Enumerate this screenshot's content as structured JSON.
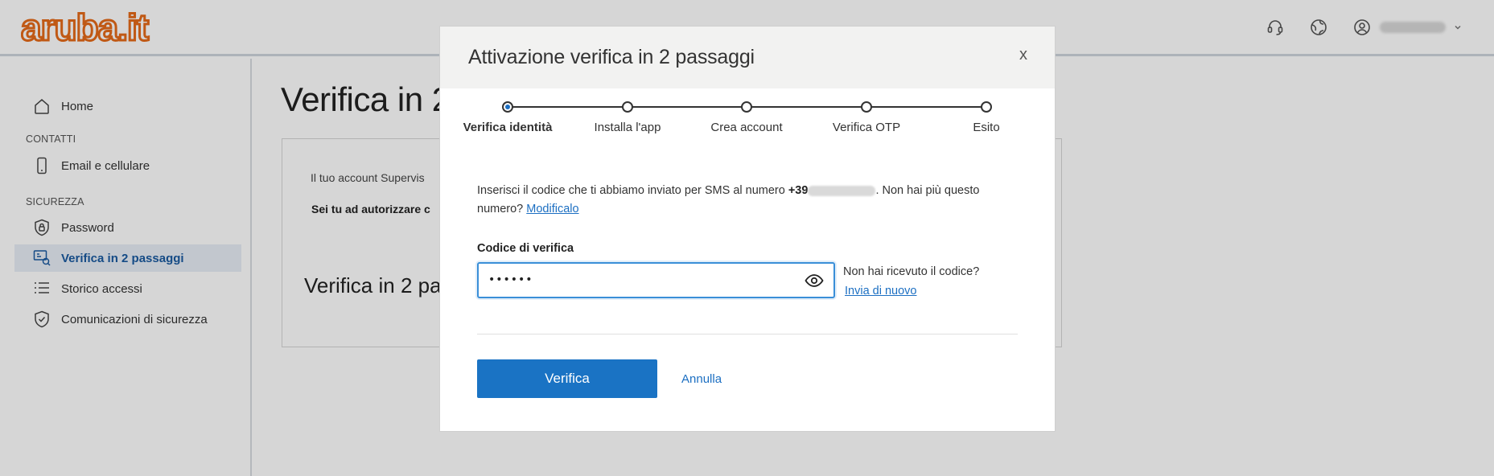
{
  "brand": {
    "logo_text": "aruba.it",
    "color": "#e56a1a"
  },
  "header": {
    "icons": [
      "headset-icon",
      "globe-icon",
      "user-circle-icon"
    ],
    "user_name": ""
  },
  "sidebar": {
    "home": "Home",
    "section_contacts": "CONTATTI",
    "email_phone": "Email e cellulare",
    "section_security": "SICUREZZA",
    "password": "Password",
    "two_step": "Verifica in 2 passaggi",
    "access_history": "Storico accessi",
    "security_comms": "Comunicazioni di sicurezza"
  },
  "main": {
    "title": "Verifica in 2",
    "card_text": "Il tuo account Supervis",
    "card_question": "Sei tu ad autorizzare c",
    "card_heading": "Verifica in 2 pas"
  },
  "modal": {
    "title": "Attivazione verifica in 2 passaggi",
    "close_label": "x",
    "steps": [
      {
        "label": "Verifica identità",
        "active": true
      },
      {
        "label": "Installa l'app",
        "active": false
      },
      {
        "label": "Crea account",
        "active": false
      },
      {
        "label": "Verifica OTP",
        "active": false
      },
      {
        "label": "Esito",
        "active": false
      }
    ],
    "info_prefix": "Inserisci il codice che ti abbiamo inviato per SMS al numero ",
    "phone_prefix": "+39",
    "info_suffix": ". Non hai più questo numero? ",
    "change_link": "Modificalo",
    "field_label": "Codice di verifica",
    "code_value": "••••••",
    "resend_question": "Non hai ricevuto il codice?",
    "resend_link": "Invia di nuovo",
    "verify_button": "Verifica",
    "cancel_button": "Annulla",
    "accent_color": "#1a73c4"
  }
}
